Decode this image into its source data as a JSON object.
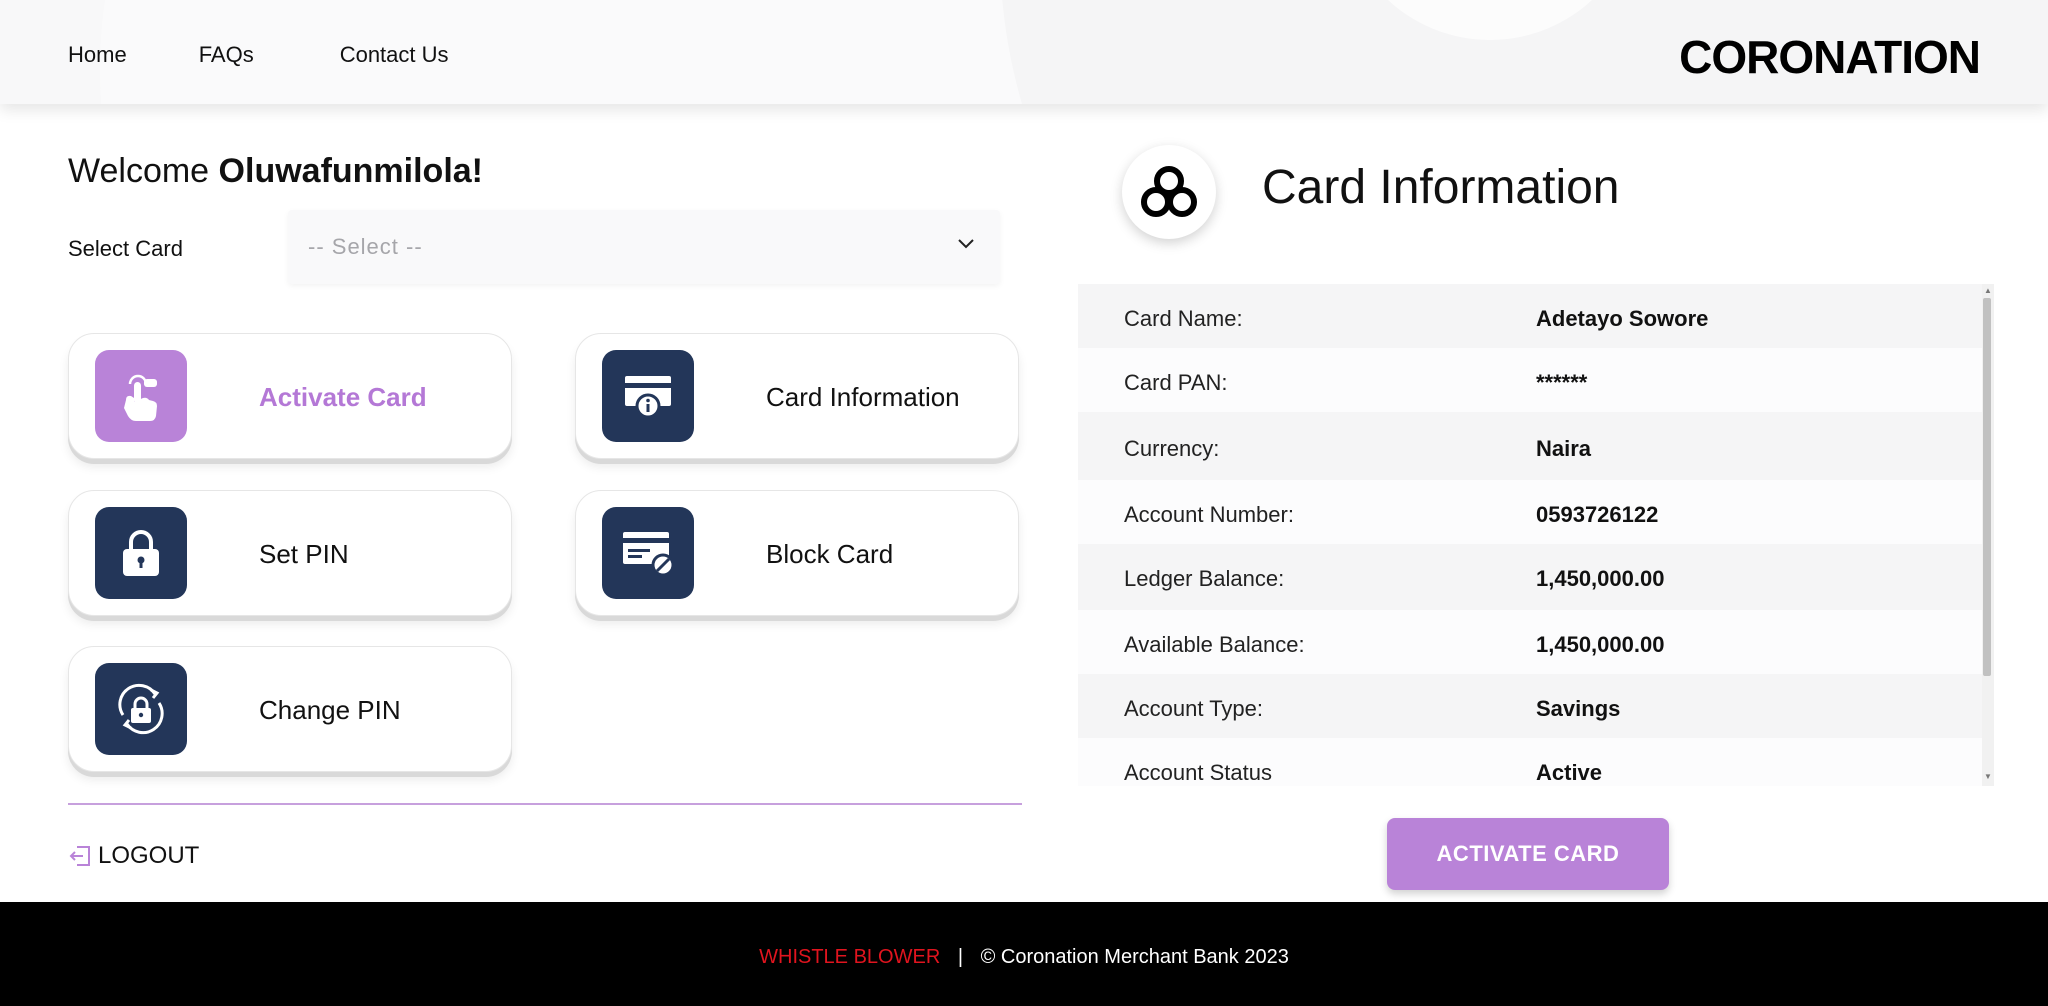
{
  "nav": {
    "home": "Home",
    "faqs": "FAQs",
    "contact": "Contact Us"
  },
  "brand": {
    "logo": "CORONATION",
    "accent": "#b983d8",
    "navy": "#233659"
  },
  "welcome": {
    "prefix": "Welcome",
    "name": "Oluwafunmilola!"
  },
  "select_card": {
    "label": "Select Card",
    "placeholder": "-- Select --"
  },
  "actions": [
    {
      "label": "Activate Card",
      "icon": "tap-finger-icon",
      "active": true
    },
    {
      "label": "Card Information",
      "icon": "card-info-icon",
      "active": false
    },
    {
      "label": "Set PIN",
      "icon": "lock-icon",
      "active": false
    },
    {
      "label": "Block Card",
      "icon": "card-block-icon",
      "active": false
    },
    {
      "label": "Change PIN",
      "icon": "lock-refresh-icon",
      "active": false
    }
  ],
  "logout": "LOGOUT",
  "card_info": {
    "title": "Card Information",
    "rows": [
      {
        "label": "Card Name:",
        "value": "Adetayo Sowore"
      },
      {
        "label": "Card PAN:",
        "value": "******"
      },
      {
        "label": "Currency:",
        "value": "Naira"
      },
      {
        "label": "Account Number:",
        "value": "0593726122"
      },
      {
        "label": "Ledger Balance:",
        "value": "1,450,000.00"
      },
      {
        "label": "Available Balance:",
        "value": "1,450,000.00"
      },
      {
        "label": "Account Type:",
        "value": "Savings"
      },
      {
        "label": "Account Status",
        "value": "Active"
      }
    ],
    "button": "ACTIVATE CARD"
  },
  "footer": {
    "whistle": "WHISTLE BLOWER",
    "separator": "|",
    "copyright": "© Coronation Merchant Bank 2023"
  }
}
